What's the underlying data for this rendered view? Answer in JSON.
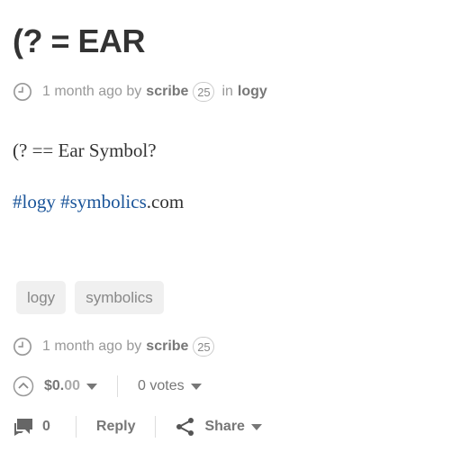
{
  "post": {
    "title": "(? = EAR",
    "meta_top": {
      "time": "1 month ago by",
      "author": "scribe",
      "reputation": "25",
      "in_label": "in",
      "category": "logy"
    },
    "body_line1": "(? == Ear Symbol?",
    "body_line2": {
      "tag1": "#logy",
      "tag2": "#symbolics",
      "suffix": ".com"
    },
    "tags": [
      "logy",
      "symbolics"
    ],
    "meta_bottom": {
      "time": "1 month ago by",
      "author": "scribe",
      "reputation": "25"
    }
  },
  "voting": {
    "payout_main": "$0.",
    "payout_cents": "00",
    "votes": "0 votes"
  },
  "actions": {
    "comment_count": "0",
    "reply_label": "Reply",
    "share_label": "Share"
  },
  "colors": {
    "text": "#333333",
    "muted": "#999999",
    "hashtag": "#1a5499",
    "tag_bg": "#f0f0f0"
  }
}
